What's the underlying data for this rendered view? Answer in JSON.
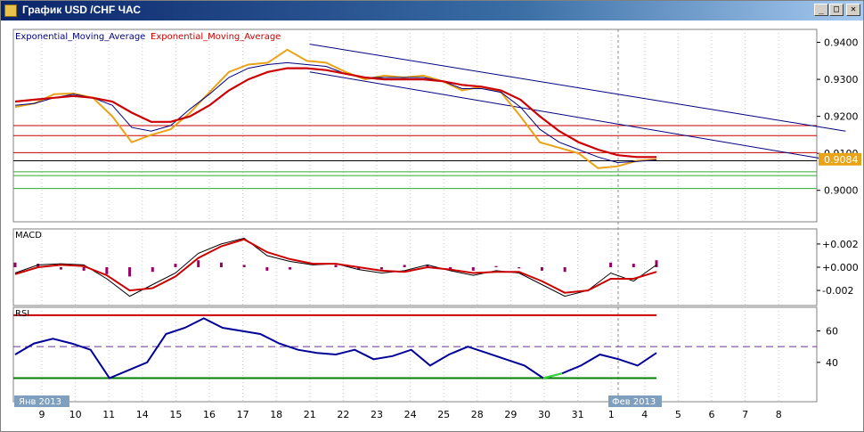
{
  "window": {
    "title": "График USD /CHF ЧАС",
    "icons": {
      "app": "chart-app-icon",
      "min": "minimize-icon",
      "max": "maximize-icon",
      "close": "close-icon"
    },
    "buttons": {
      "minimize": "_",
      "maximize": "□",
      "close": "✕"
    }
  },
  "chart_data": [
    {
      "type": "line",
      "name": "price",
      "symbol": "USD/CHF",
      "timeframe": "H1",
      "ylim": [
        0.8915,
        0.9435
      ],
      "yticks": [
        "0.9400",
        "0.9300",
        "0.9200",
        "0.9100",
        "0.9000"
      ],
      "legend": [
        "Exponential_Moving_Average",
        "Exponential_Moving_Average"
      ],
      "current_price": "0.9084",
      "x_days": [
        "9",
        "10",
        "11",
        "14",
        "15",
        "16",
        "17",
        "18",
        "21",
        "22",
        "23",
        "24",
        "25",
        "28",
        "29",
        "30",
        "31",
        "1",
        "4",
        "5",
        "6",
        "7",
        "8"
      ],
      "series": [
        {
          "color": "#e8a317",
          "values": [
            0.9225,
            0.9235,
            0.926,
            0.9262,
            0.925,
            0.92,
            0.913,
            0.915,
            0.9165,
            0.921,
            0.9265,
            0.932,
            0.934,
            0.9345,
            0.938,
            0.935,
            0.9345,
            0.932,
            0.93,
            0.931,
            0.9305,
            0.931,
            0.9295,
            0.927,
            0.928,
            0.9265,
            0.92,
            0.913,
            0.9115,
            0.91,
            0.906,
            0.9065,
            0.908,
            0.9084
          ]
        },
        {
          "color": "#000080",
          "values": [
            0.923,
            0.9235,
            0.925,
            0.926,
            0.925,
            0.923,
            0.917,
            0.916,
            0.9175,
            0.922,
            0.926,
            0.9305,
            0.933,
            0.934,
            0.9345,
            0.934,
            0.9335,
            0.9315,
            0.9305,
            0.9305,
            0.9305,
            0.9305,
            0.9295,
            0.9275,
            0.9275,
            0.9265,
            0.9225,
            0.9165,
            0.913,
            0.911,
            0.909,
            0.9075,
            0.9078,
            0.9082
          ]
        },
        {
          "color": "#cc0000",
          "values": [
            0.924,
            0.9245,
            0.925,
            0.9255,
            0.925,
            0.924,
            0.921,
            0.9185,
            0.9185,
            0.92,
            0.923,
            0.927,
            0.93,
            0.932,
            0.933,
            0.933,
            0.9325,
            0.9315,
            0.9305,
            0.93,
            0.93,
            0.93,
            0.9295,
            0.9285,
            0.928,
            0.927,
            0.9245,
            0.92,
            0.916,
            0.913,
            0.911,
            0.9095,
            0.909,
            0.909
          ]
        }
      ],
      "hlines": [
        {
          "y": 0.9175,
          "color": "#cc0000"
        },
        {
          "y": 0.9148,
          "color": "#cc0000"
        },
        {
          "y": 0.9102,
          "color": "#cc0000"
        },
        {
          "y": 0.908,
          "color": "#000000"
        },
        {
          "y": 0.905,
          "color": "#33aa33"
        },
        {
          "y": 0.904,
          "color": "#33aa33"
        },
        {
          "y": 0.9005,
          "color": "#33aa33"
        }
      ],
      "trendlines": [
        {
          "from": [
            8.0,
            0.9395
          ],
          "to": [
            24.0,
            0.916
          ],
          "color": "#000080"
        },
        {
          "from": [
            8.0,
            0.932
          ],
          "to": [
            24.0,
            0.9075
          ],
          "color": "#000080"
        }
      ]
    },
    {
      "type": "line",
      "name": "macd",
      "label": "MACD",
      "ylim": [
        -0.0033,
        0.0033
      ],
      "yticks": [
        "+0.002",
        "+0.000",
        "-0.002"
      ],
      "histogram_color": "#990066",
      "series": [
        {
          "color": "#000000",
          "values": [
            -0.0005,
            0.0002,
            0.0003,
            0.0002,
            -0.001,
            -0.0025,
            -0.0015,
            -0.0005,
            0.0012,
            0.002,
            0.0025,
            0.001,
            0.0005,
            0.0002,
            0.0003,
            -0.0002,
            -0.0005,
            -0.0003,
            0.0002,
            -0.0003,
            -0.0007,
            -0.0003,
            -0.0005,
            -0.0015,
            -0.0025,
            -0.002,
            -0.0005,
            -0.0012,
            0.0002
          ]
        },
        {
          "color": "#cc0000",
          "values": [
            -0.0006,
            0.0,
            0.0002,
            0.0001,
            -0.0007,
            -0.002,
            -0.0018,
            -0.0008,
            0.0008,
            0.0018,
            0.0024,
            0.0013,
            0.0007,
            0.0003,
            0.0003,
            0.0,
            -0.0003,
            -0.0004,
            0.0,
            -0.0002,
            -0.0005,
            -0.0004,
            -0.0004,
            -0.0012,
            -0.0022,
            -0.002,
            -0.001,
            -0.001,
            -0.0004
          ]
        }
      ],
      "histogram": [
        0.0004,
        0.0003,
        -0.0002,
        -0.0003,
        -0.0006,
        -0.0008,
        -0.0004,
        0.0003,
        0.0006,
        0.0004,
        0.0002,
        -0.0003,
        -0.0002,
        0.0,
        0.0002,
        -0.0002,
        -0.0002,
        0.0002,
        0.0002,
        -0.0002,
        -0.0003,
        0.0001,
        -0.0001,
        -0.0003,
        -0.0004,
        0.0,
        0.0004,
        0.0003,
        0.0006
      ]
    },
    {
      "type": "line",
      "name": "rsi",
      "label": "RSI",
      "ylim": [
        15,
        75
      ],
      "yticks": [
        "60",
        "40"
      ],
      "levels": [
        {
          "y": 70,
          "color": "#cc0000",
          "dashed": false
        },
        {
          "y": 50,
          "color": "#663399",
          "dashed": true
        },
        {
          "y": 30,
          "color": "#008000",
          "dashed": false
        }
      ],
      "series": [
        {
          "color": "#000099",
          "values": [
            45,
            52,
            55,
            52,
            48,
            30,
            35,
            40,
            58,
            62,
            68,
            62,
            60,
            58,
            52,
            48,
            46,
            45,
            48,
            42,
            44,
            48,
            38,
            45,
            50,
            46,
            42,
            38,
            30,
            33,
            38,
            45,
            42,
            38,
            46
          ]
        }
      ],
      "oversold_segments_color": "#33dd33"
    }
  ],
  "date_labels": {
    "left": "Янв 2013",
    "right": "Фев 2013"
  }
}
